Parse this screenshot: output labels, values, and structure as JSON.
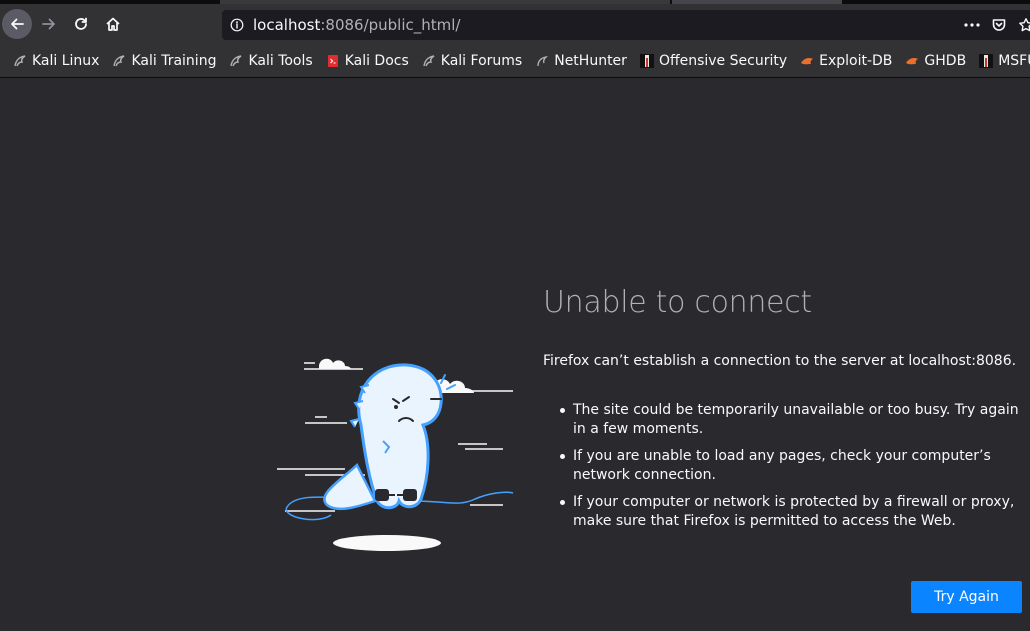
{
  "browser": {
    "url_host": "localhost",
    "url_rest": ":8086/public_html/",
    "icons": {
      "back": "back-arrow-icon",
      "forward": "forward-arrow-icon",
      "reload": "reload-icon",
      "home": "home-icon",
      "site_info": "info-icon",
      "page_actions": "more-horizontal-icon",
      "pocket": "pocket-icon",
      "bookmark": "star-icon"
    }
  },
  "bookmarks": [
    {
      "label": "Kali Linux",
      "icon": "kali-dragon-icon"
    },
    {
      "label": "Kali Training",
      "icon": "kali-dragon-icon"
    },
    {
      "label": "Kali Tools",
      "icon": "kali-dragon-icon"
    },
    {
      "label": "Kali Docs",
      "icon": "kali-docs-icon"
    },
    {
      "label": "Kali Forums",
      "icon": "kali-dragon-icon"
    },
    {
      "label": "NetHunter",
      "icon": "nethunter-icon"
    },
    {
      "label": "Offensive Security",
      "icon": "offsec-icon"
    },
    {
      "label": "Exploit-DB",
      "icon": "exploitdb-icon"
    },
    {
      "label": "GHDB",
      "icon": "exploitdb-icon"
    },
    {
      "label": "MSFU",
      "icon": "offsec-icon"
    }
  ],
  "error": {
    "title": "Unable to connect",
    "description": "Firefox can’t establish a connection to the server at localhost:8086.",
    "items": [
      "The site could be temporarily unavailable or too busy. Try again in a few moments.",
      "If you are unable to load any pages, check your computer’s network connection.",
      "If your computer or network is protected by a firewall or proxy, make sure that Firefox is permitted to access the Web."
    ],
    "button_label": "Try Again",
    "illustration": "unplugged-dinosaur-illustration"
  },
  "colors": {
    "accent": "#0a84ff",
    "background": "#2a2a2e",
    "toolbar": "#323234",
    "urlbar": "#1c1b22"
  }
}
